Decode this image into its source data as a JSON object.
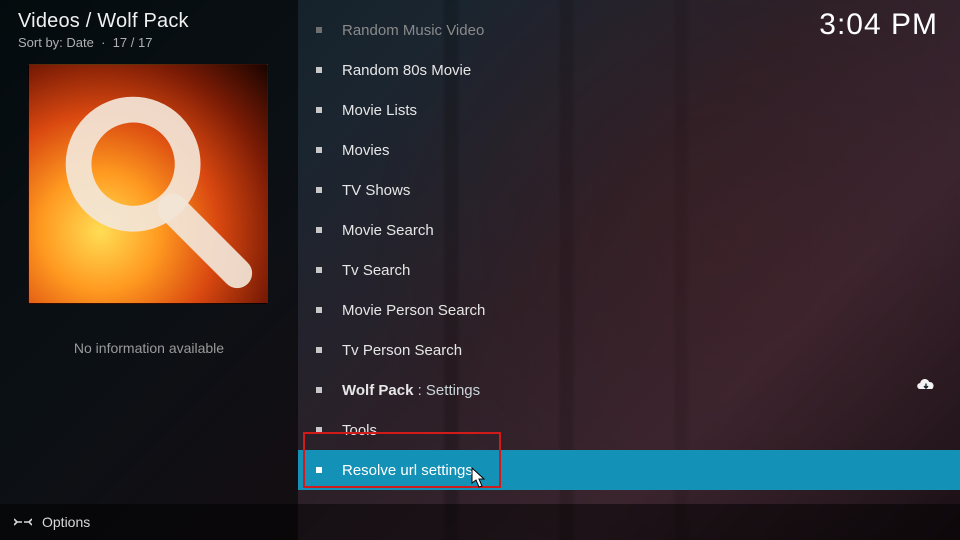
{
  "header": {
    "breadcrumb": "Videos / Wolf Pack",
    "sort_prefix": "Sort by:",
    "sort_value": "Date",
    "count": "17 / 17"
  },
  "clock": "3:04 PM",
  "sidebar": {
    "noinfo": "No information available"
  },
  "menu": {
    "items": [
      {
        "label": "Random Music Video",
        "faded": true
      },
      {
        "label": "Random 80s Movie"
      },
      {
        "label": "Movie Lists"
      },
      {
        "label": "Movies"
      },
      {
        "label": "TV Shows"
      },
      {
        "label": "Movie Search"
      },
      {
        "label": "Tv Search"
      },
      {
        "label": "Movie Person Search"
      },
      {
        "label": "Tv Person Search"
      },
      {
        "label_bold": "Wolf Pack",
        "label_suffix": " : Settings"
      },
      {
        "label": "Tools"
      },
      {
        "label": "Resolve url settings",
        "selected": true
      }
    ]
  },
  "footer": {
    "options": "Options"
  }
}
